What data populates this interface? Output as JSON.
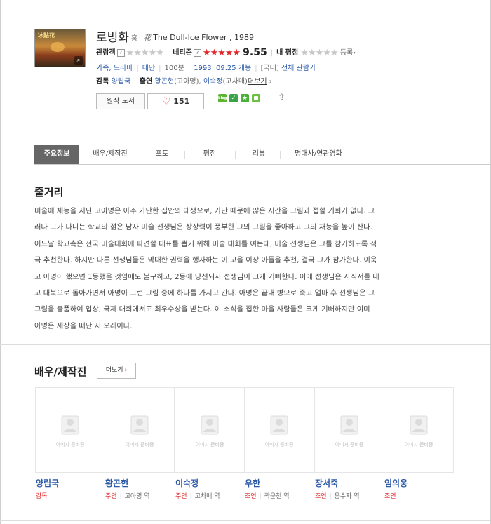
{
  "movie": {
    "title": "로빙화",
    "badge": "홍",
    "icon_char": "花",
    "eng_title": "The Dull-Ice Flower , 1989",
    "poster_text": "冰點花"
  },
  "ratings": {
    "audience_label": "관람객",
    "audience_stars": "★★★★★",
    "netizen_label": "네티즌",
    "netizen_stars": "★★★★★",
    "netizen_score": "9.55",
    "my_label": "내 평점",
    "my_stars": "★★★★★",
    "register": "등록"
  },
  "info": {
    "genre": "가족, 드라마",
    "country": "대만",
    "runtime": "100분",
    "release": "1993 .09.25 개봉",
    "domestic": "[국내]",
    "grade": "전체 관람가",
    "director_label": "감독",
    "director": "양립국",
    "cast_label": "출연",
    "cast1": "황곤현",
    "cast1_role": "(고아명),",
    "cast2": "이숙정",
    "cast2_role": "(고차매)",
    "more": "더보기"
  },
  "buttons": {
    "book": "원작 도서",
    "likes": "151"
  },
  "icon_colors": {
    "blog": "#5cb531",
    "twitter": "#3aa34a",
    "star": "#49b13a",
    "me2": "#6cc043"
  },
  "tabs": [
    "주요정보",
    "배우/제작진",
    "포토",
    "평점",
    "리뷰",
    "명대사/연관영화"
  ],
  "synopsis": {
    "heading": "줄거리",
    "lines": [
      "미술에 재능을 지닌 고아명은 아주 가난한 집안의 태생으로, 가난 때문에 많은 시간을 그림과 접할 기회가 없다. 그",
      "러나 그가 다니는 학교의 젊은 남자 미술 선생님은 상상력이 풍부한 그의 그림을 좋아하고 그의 재능을 높이 산다.",
      "어느날 학교측은 전국 미술대회에 파견할 대표를 뽑기 위해 미술 대회를 여는데, 미술 선생님은 그를 참가하도록 적",
      "극 추천한다. 하지만 다른 선생님들은 막대한 권력을 행사하는 이 고을 이장 아들을 추천, 결국 그가 참가한다. 이욱",
      "고 아명이 했으면 1등했을 것임에도 불구하고, 2등에 당선되자 선생님이 크게 기뻐한다. 이에 선생님은 사직서를 내",
      "고 대북으로 돌아가면서 아명이 그런 그림 중에 하나를 가지고 간다. 아명은 끝내 병으로 죽고 얼마 후 선생님은 그",
      "그림을 출품하여 입상, 국제 대회에서도 최우수상을 받는다. 이 소식을 접한 마을 사람들은 크게 기뻐하지만 이미",
      "아명은 세상을 떠난 지 오래이다."
    ]
  },
  "cast_section": {
    "heading": "배우/제작진",
    "more": "더보기",
    "placeholder": "이미지 준비중",
    "people": [
      {
        "name": "양립국",
        "role": "감독",
        "char": ""
      },
      {
        "name": "황곤현",
        "role": "주연",
        "char": "고아명 역"
      },
      {
        "name": "이숙정",
        "role": "주연",
        "char": "고차매 역"
      },
      {
        "name": "우한",
        "role": "조연",
        "char": "곽운천 역"
      },
      {
        "name": "장서죽",
        "role": "조연",
        "char": "옹수자 역"
      },
      {
        "name": "임의웅",
        "role": "조연",
        "char": ""
      }
    ]
  }
}
